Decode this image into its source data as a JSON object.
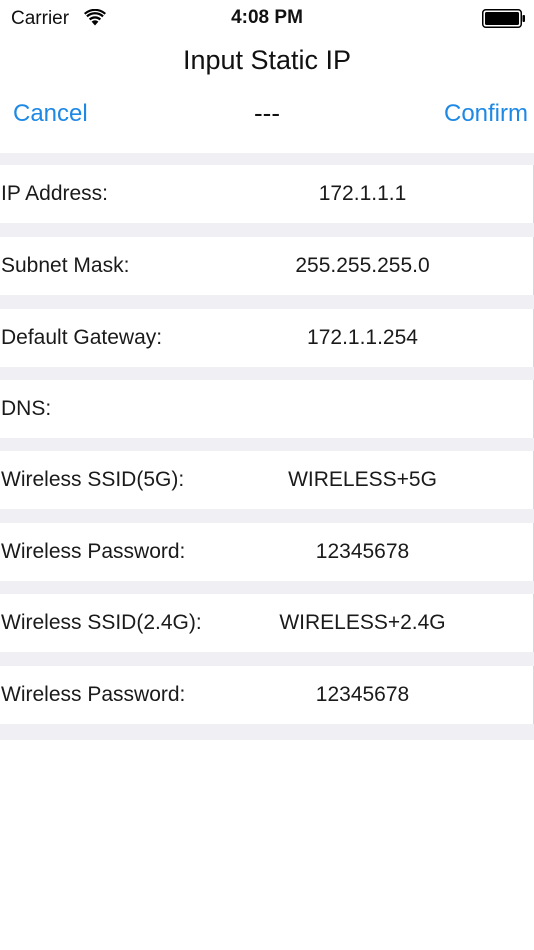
{
  "status_bar": {
    "carrier": "Carrier",
    "time": "4:08 PM"
  },
  "nav": {
    "title": "Input Static IP",
    "cancel_label": "Cancel",
    "center_label": "---",
    "confirm_label": "Confirm",
    "accent_color": "#1e88e5"
  },
  "form": {
    "rows": [
      {
        "label": "IP Address:",
        "value": "172.1.1.1"
      },
      {
        "label": "Subnet Mask:",
        "value": "255.255.255.0"
      },
      {
        "label": "Default Gateway:",
        "value": "172.1.1.254"
      },
      {
        "label": "DNS:",
        "value": ""
      },
      {
        "label": "Wireless SSID(5G):",
        "value": "WIRELESS+5G"
      },
      {
        "label": "Wireless Password:",
        "value": "12345678"
      },
      {
        "label": "Wireless SSID(2.4G):",
        "value": "WIRELESS+2.4G"
      },
      {
        "label": "Wireless Password:",
        "value": "12345678"
      }
    ]
  },
  "icons": {
    "wifi": "wifi-icon",
    "battery": "battery-icon"
  }
}
